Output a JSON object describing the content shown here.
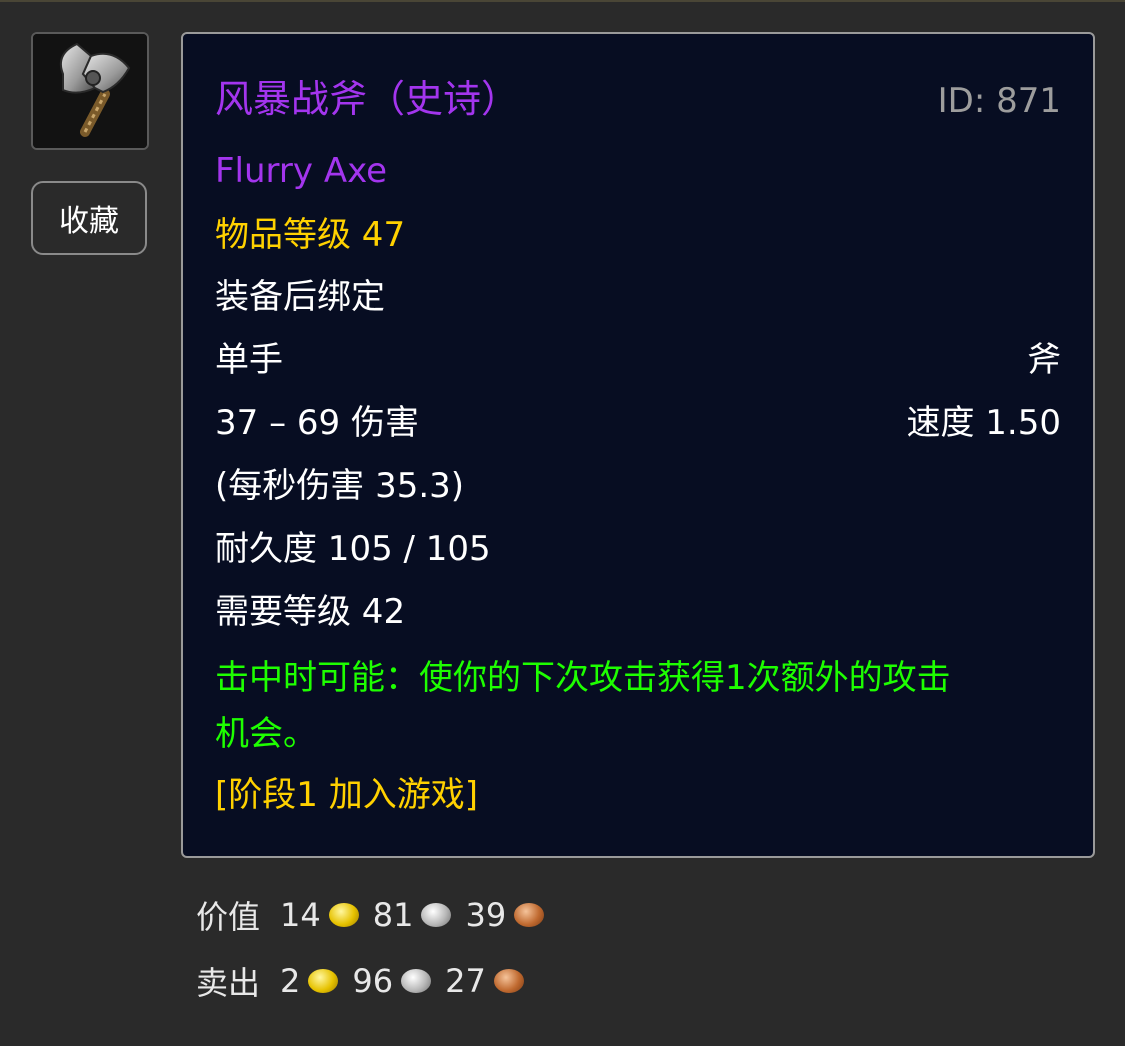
{
  "item": {
    "name_cn": "风暴战斧（史诗）",
    "id_label": "ID: 871",
    "name_en": "Flurry Axe",
    "item_level": "物品等级 47",
    "binding": "装备后绑定",
    "slot": "单手",
    "weapon_type": "斧",
    "damage": "37 – 69 伤害",
    "speed": "速度 1.50",
    "dps": "(每秒伤害 35.3)",
    "durability": "耐久度 105 / 105",
    "required_level": "需要等级 42",
    "effect_line1": "击中时可能：使你的下次攻击获得1次额外的攻击",
    "effect_line2": "机会。",
    "phase": "[阶段1 加入游戏]"
  },
  "actions": {
    "favorite_label": "收藏"
  },
  "price": {
    "value_label": "价值",
    "value_gold": "14",
    "value_silver": "81",
    "value_copper": "39",
    "sell_label": "卖出",
    "sell_gold": "2",
    "sell_silver": "96",
    "sell_copper": "27"
  },
  "colors": {
    "epic": "#a335ee",
    "gold_text": "#ffd100",
    "effect_green": "#1eff00",
    "tooltip_bg": "#070d22",
    "page_bg": "#2a2a2a"
  },
  "icons": {
    "item_icon": "axe-icon",
    "gold_coin": "gold-coin-icon",
    "silver_coin": "silver-coin-icon",
    "copper_coin": "copper-coin-icon"
  }
}
